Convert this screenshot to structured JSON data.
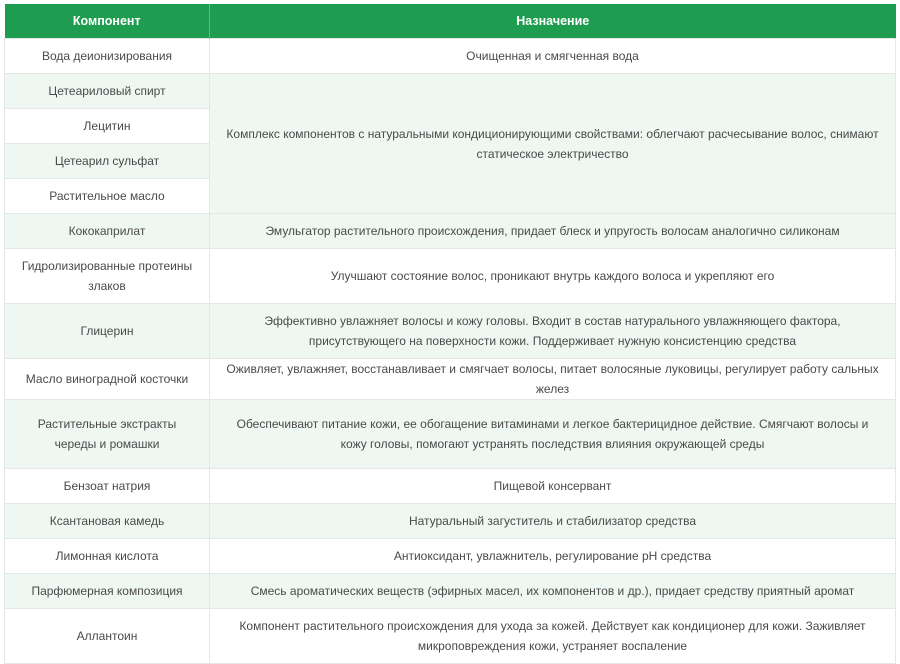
{
  "headers": {
    "component": "Компонент",
    "purpose": "Назначение"
  },
  "rows": [
    {
      "component": "Вода деионизирования",
      "purpose": "Очищенная и смягченная вода"
    },
    {
      "component": "Цетеариловый спирт"
    },
    {
      "component": "Лецитин"
    },
    {
      "component": "Цетеарил сульфат"
    },
    {
      "component": "Растительное масло"
    },
    {
      "component": "Кококаприлат",
      "purpose": "Эмульгатор растительного происхождения, придает блеск и упругость волосам аналогично силиконам"
    },
    {
      "component": "Гидролизированные протеины злаков",
      "purpose": "Улучшают состояние волос, проникают внутрь каждого волоса и укрепляют его"
    },
    {
      "component": "Глицерин",
      "purpose": "Эффективно увлажняет волосы и кожу головы. Входит в состав натурального увлажняющего фактора, присутствующего на поверхности кожи. Поддерживает нужную консистенцию средства"
    },
    {
      "component": "Масло виноградной косточки",
      "purpose": "Оживляет, увлажняет, восстанавливает и смягчает волосы, питает волосяные луковицы, регулирует работу сальных желез"
    },
    {
      "component": "Растительные экстракты череды и ромашки",
      "purpose": "Обеспечивают питание кожи, ее обогащение витаминами и легкое бактерицидное действие.  Смягчают волосы и кожу головы, помогают устранять последствия влияния окружающей среды"
    },
    {
      "component": "Бензоат натрия",
      "purpose": "Пищевой консервант"
    },
    {
      "component": "Ксантановая камедь",
      "purpose": "Натуральный загуститель и стабилизатор средства"
    },
    {
      "component": "Лимонная кислота",
      "purpose": "Антиоксидант, увлажнитель, регулирование pH средства"
    },
    {
      "component": "Парфюмерная композиция",
      "purpose": "Смесь ароматических веществ (эфирных масел, их компонентов и др.), придает средству приятный аромат"
    },
    {
      "component": "Аллантоин",
      "purpose": "Компонент растительного происхождения для ухода за кожей. Действует как кондиционер для кожи. Заживляет микроповреждения кожи, устраняет воспаление"
    }
  ],
  "merged_purpose": "Комплекс компонентов с натуральными кондиционирующими свойствами: облегчают расчесывание волос, снимают статическое электричество",
  "colors": {
    "header_bg": "#1e9c4f",
    "alt_row_bg": "#eef7f1",
    "text": "#4a4a4a"
  }
}
